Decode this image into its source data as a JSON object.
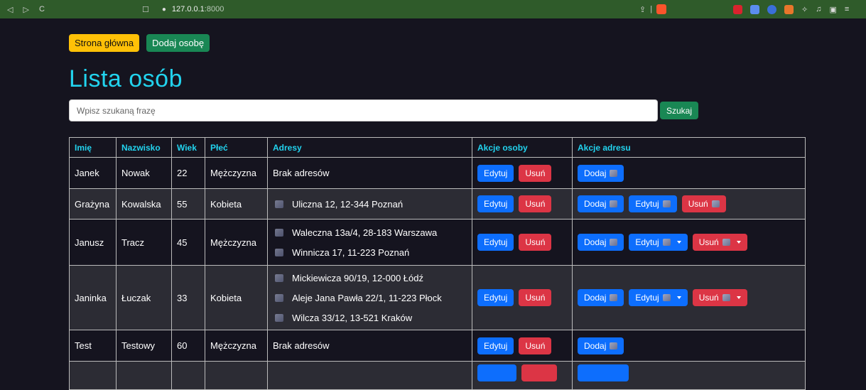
{
  "browser": {
    "back": "◁",
    "forward": "▷",
    "reload": "C",
    "bookmark": "☐",
    "url_host": "127.0.0.1",
    "url_port": ":8000"
  },
  "header": {
    "home_button": "Strona główna",
    "add_person_button": "Dodaj osobę",
    "title": "Lista osób"
  },
  "search": {
    "placeholder": "Wpisz szukaną frazę",
    "button": "Szukaj"
  },
  "table": {
    "columns": [
      "Imię",
      "Nazwisko",
      "Wiek",
      "Płeć",
      "Adresy",
      "Akcje osoby",
      "Akcje adresu"
    ],
    "edit_label": "Edytuj",
    "delete_label": "Usuń",
    "add_label": "Dodaj",
    "no_address": "Brak adresów",
    "rows": [
      {
        "first": "Janek",
        "last": "Nowak",
        "age": "22",
        "gender": "Mężczyzna",
        "addresses": []
      },
      {
        "first": "Grażyna",
        "last": "Kowalska",
        "age": "55",
        "gender": "Kobieta",
        "addresses": [
          "Uliczna 12, 12-344 Poznań"
        ]
      },
      {
        "first": "Janusz",
        "last": "Tracz",
        "age": "45",
        "gender": "Mężczyzna",
        "addresses": [
          "Waleczna 13a/4, 28-183 Warszawa",
          "Winnicza 17, 11-223 Poznań"
        ]
      },
      {
        "first": "Janinka",
        "last": "Łuczak",
        "age": "33",
        "gender": "Kobieta",
        "addresses": [
          "Mickiewicza 90/19, 12-000 Łódź",
          "Aleje Jana Pawła 22/1, 11-223 Płock",
          "Wilcza 33/12, 13-521 Kraków"
        ]
      },
      {
        "first": "Test",
        "last": "Testowy",
        "age": "60",
        "gender": "Mężczyzna",
        "addresses": []
      }
    ]
  },
  "colors": {
    "title": "#22d3ee",
    "primary": "#0d6efd",
    "danger": "#dc3545",
    "success": "#198754",
    "warning": "#ffc107",
    "background": "#15141f"
  }
}
